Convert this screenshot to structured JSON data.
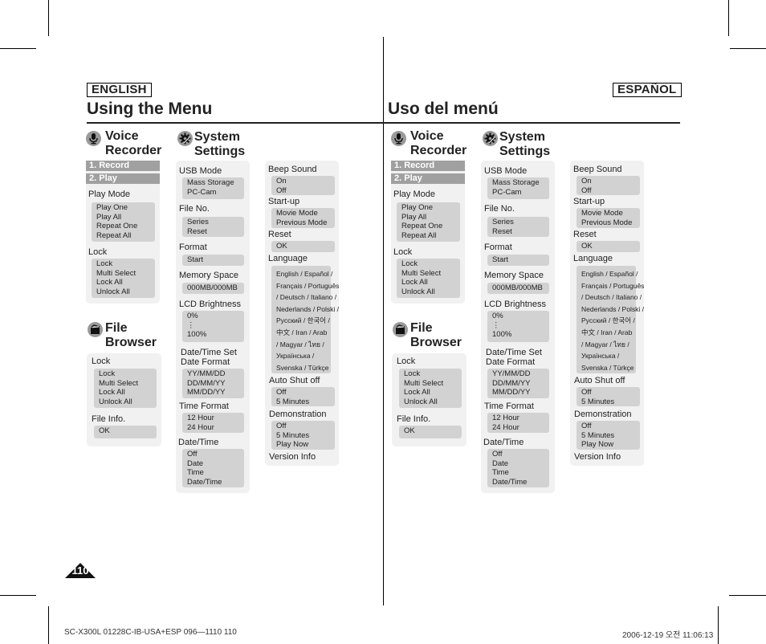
{
  "english": {
    "badge": "ENGLISH",
    "title": "Using the Menu",
    "voice_recorder": {
      "title_line1": "Voice",
      "title_line2": "Recorder",
      "icon": "microphone-icon",
      "tabs": [
        "1. Record",
        "2. Play"
      ],
      "groups": [
        {
          "label": "Play Mode",
          "options": [
            "Play One",
            "Play All",
            "Repeat One",
            "Repeat All"
          ]
        },
        {
          "label": "Lock",
          "options": [
            "Lock",
            "Multi Select",
            "Lock All",
            "Unlock All"
          ]
        }
      ]
    },
    "file_browser": {
      "title_line1": "File",
      "title_line2": "Browser",
      "icon": "folder-icon",
      "groups": [
        {
          "label": "Lock",
          "options": [
            "Lock",
            "Multi Select",
            "Lock All",
            "Unlock All"
          ]
        },
        {
          "label": "File Info.",
          "options": [
            "OK"
          ]
        }
      ]
    },
    "system_settings": {
      "title_line1": "System",
      "title_line2": "Settings",
      "icon": "gear-icon",
      "col1": [
        {
          "label": "USB Mode",
          "options": [
            "Mass Storage",
            "PC-Cam"
          ]
        },
        {
          "label": "File No.",
          "options": [
            "Series",
            "Reset"
          ]
        },
        {
          "label": "Format",
          "options": [
            "Start"
          ]
        },
        {
          "label": "Memory Space",
          "options": [
            "000MB/000MB"
          ]
        },
        {
          "label": "LCD Brightness",
          "options": [
            "0%",
            "⋮",
            "100%"
          ]
        },
        {
          "label": "Date/Time Set",
          "sublabel": "Date Format",
          "options": [
            "YY/MM/DD",
            "DD/MM/YY",
            "MM/DD/YY"
          ]
        },
        {
          "label": "Time Format",
          "options": [
            "12 Hour",
            "24 Hour"
          ]
        },
        {
          "label": "Date/Time",
          "options": [
            "Off",
            "Date",
            "Time",
            "Date/Time"
          ]
        }
      ],
      "col2": [
        {
          "label": "Beep Sound",
          "options": [
            "On",
            "Off"
          ]
        },
        {
          "label": "Start-up",
          "options": [
            "Movie Mode",
            "Previous Mode"
          ]
        },
        {
          "label": "Reset",
          "options": [
            "OK"
          ]
        },
        {
          "label": "Language",
          "options": [
            "English / Español /",
            "Français / Português",
            "/ Deutsch / Italiano /",
            "Nederlands / Polski /",
            "Русский / 한국어 /",
            "中文 / Iran / Arab",
            "/ Magyar / ไทย /",
            "Українська /",
            "Svenska / Türkçe"
          ]
        },
        {
          "label": "Auto Shut off",
          "options": [
            "Off",
            "5 Minutes"
          ]
        },
        {
          "label": "Demonstration",
          "options": [
            "Off",
            "5 Minutes",
            "Play Now"
          ]
        },
        {
          "label": "Version Info",
          "options": []
        }
      ]
    }
  },
  "spanish": {
    "badge": "ESPAÑOL",
    "title": "Uso del menú",
    "voice_recorder": {
      "title_line1": "Voice",
      "title_line2": "Recorder",
      "icon": "microphone-icon",
      "tabs": [
        "1. Record",
        "2. Play"
      ],
      "groups": [
        {
          "label": "Play Mode",
          "options": [
            "Play One",
            "Play All",
            "Repeat One",
            "Repeat All"
          ]
        },
        {
          "label": "Lock",
          "options": [
            "Lock",
            "Multi Select",
            "Lock All",
            "Unlock All"
          ]
        }
      ]
    },
    "file_browser": {
      "title_line1": "File",
      "title_line2": "Browser",
      "icon": "folder-icon",
      "groups": [
        {
          "label": "Lock",
          "options": [
            "Lock",
            "Multi Select",
            "Lock All",
            "Unlock All"
          ]
        },
        {
          "label": "File Info.",
          "options": [
            "OK"
          ]
        }
      ]
    },
    "system_settings": {
      "title_line1": "System",
      "title_line2": "Settings",
      "icon": "gear-icon",
      "col1": [
        {
          "label": "USB Mode",
          "options": [
            "Mass Storage",
            "PC-Cam"
          ]
        },
        {
          "label": "File No.",
          "options": [
            "Series",
            "Reset"
          ]
        },
        {
          "label": "Format",
          "options": [
            "Start"
          ]
        },
        {
          "label": "Memory Space",
          "options": [
            "000MB/000MB"
          ]
        },
        {
          "label": "LCD Brightness",
          "options": [
            "0%",
            "⋮",
            "100%"
          ]
        },
        {
          "label": "Date/Time Set",
          "sublabel": "Date Format",
          "options": [
            "YY/MM/DD",
            "DD/MM/YY",
            "MM/DD/YY"
          ]
        },
        {
          "label": "Time Format",
          "options": [
            "12 Hour",
            "24 Hour"
          ]
        },
        {
          "label": "Date/Time",
          "options": [
            "Off",
            "Date",
            "Time",
            "Date/Time"
          ]
        }
      ],
      "col2": [
        {
          "label": "Beep Sound",
          "options": [
            "On",
            "Off"
          ]
        },
        {
          "label": "Start-up",
          "options": [
            "Movie Mode",
            "Previous Mode"
          ]
        },
        {
          "label": "Reset",
          "options": [
            "OK"
          ]
        },
        {
          "label": "Language",
          "options": [
            "English / Español /",
            "Français / Português",
            "/ Deutsch / Italiano /",
            "Nederlands / Polski /",
            "Русский / 한국어 /",
            "中文 / Iran / Arab",
            "/ Magyar / ไทย /",
            "Українська /",
            "Svenska / Türkçe"
          ]
        },
        {
          "label": "Auto Shut off",
          "options": [
            "Off",
            "5 Minutes"
          ]
        },
        {
          "label": "Demonstration",
          "options": [
            "Off",
            "5 Minutes",
            "Play Now"
          ]
        },
        {
          "label": "Version Info",
          "options": []
        }
      ]
    }
  },
  "page_number": "110",
  "footer": {
    "left": "SC-X300L 01228C-IB-USA+ESP 096—1110   110",
    "right": "2006-12-19   오전 11:06:13"
  },
  "colors": {
    "tab": "#a0a0a0",
    "panel": "#f1f1f1",
    "option_box": "#d2d2d2",
    "icon_circle": "#9a9a9a"
  }
}
